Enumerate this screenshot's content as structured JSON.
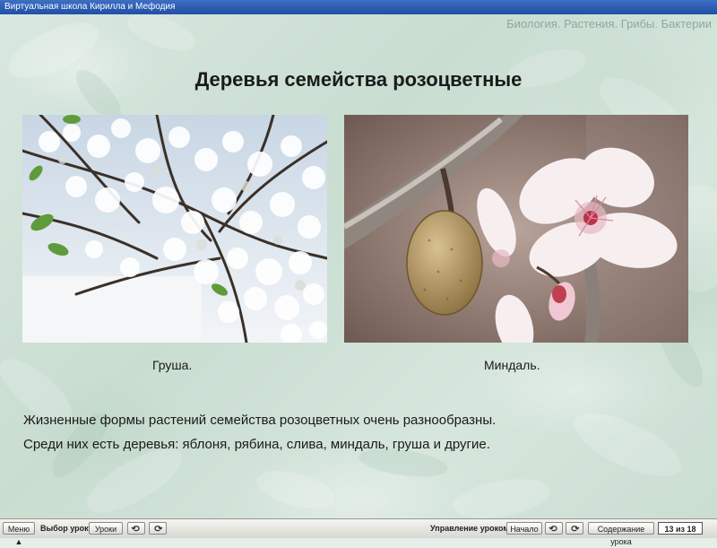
{
  "window": {
    "title": "Виртуальная школа Кирилла и Мефодия"
  },
  "header": {
    "subject": "Биология. Растения. Грибы. Бактерии"
  },
  "slide": {
    "title": "Деревья семейства розоцветные",
    "images": [
      {
        "caption": "Груша."
      },
      {
        "caption": "Миндаль."
      }
    ],
    "body": [
      "Жизненные формы растений семейства розоцветных очень разнообразны.",
      "Среди них есть деревья: яблоня, рябина, слива, миндаль, груша и другие."
    ]
  },
  "toolbar": {
    "menu_label": "Меню ▲",
    "choose_lesson_label": "Выбор урока:",
    "lessons_button": "Уроки",
    "lesson_control_label": "Управление уроком:",
    "start_button": "Начало",
    "contents_button": "Содержание урока",
    "counter": "13 из 18"
  },
  "icons": {
    "prev": "undo-arrow-icon",
    "next": "redo-arrow-icon"
  },
  "colors": {
    "title_bar": "#2a5cb5",
    "background": "#d3e4d9"
  }
}
